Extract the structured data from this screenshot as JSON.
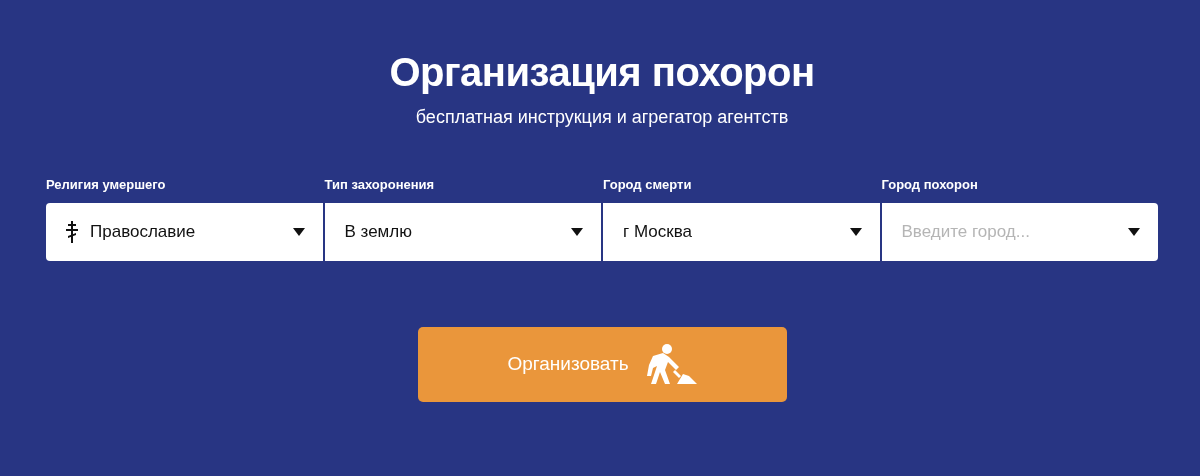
{
  "title": "Организация похорон",
  "subtitle": "бесплатная инструкция и агрегатор агентств",
  "fields": [
    {
      "label": "Религия умершего",
      "kind": "icon-select",
      "value": "Православие"
    },
    {
      "label": "Тип захоронения",
      "kind": "select",
      "value": "В землю"
    },
    {
      "label": "Город смерти",
      "kind": "select",
      "value": "г Москва"
    },
    {
      "label": "Город похорон",
      "kind": "select",
      "placeholder": "Введите город..."
    }
  ],
  "button": {
    "label": "Организовать"
  }
}
